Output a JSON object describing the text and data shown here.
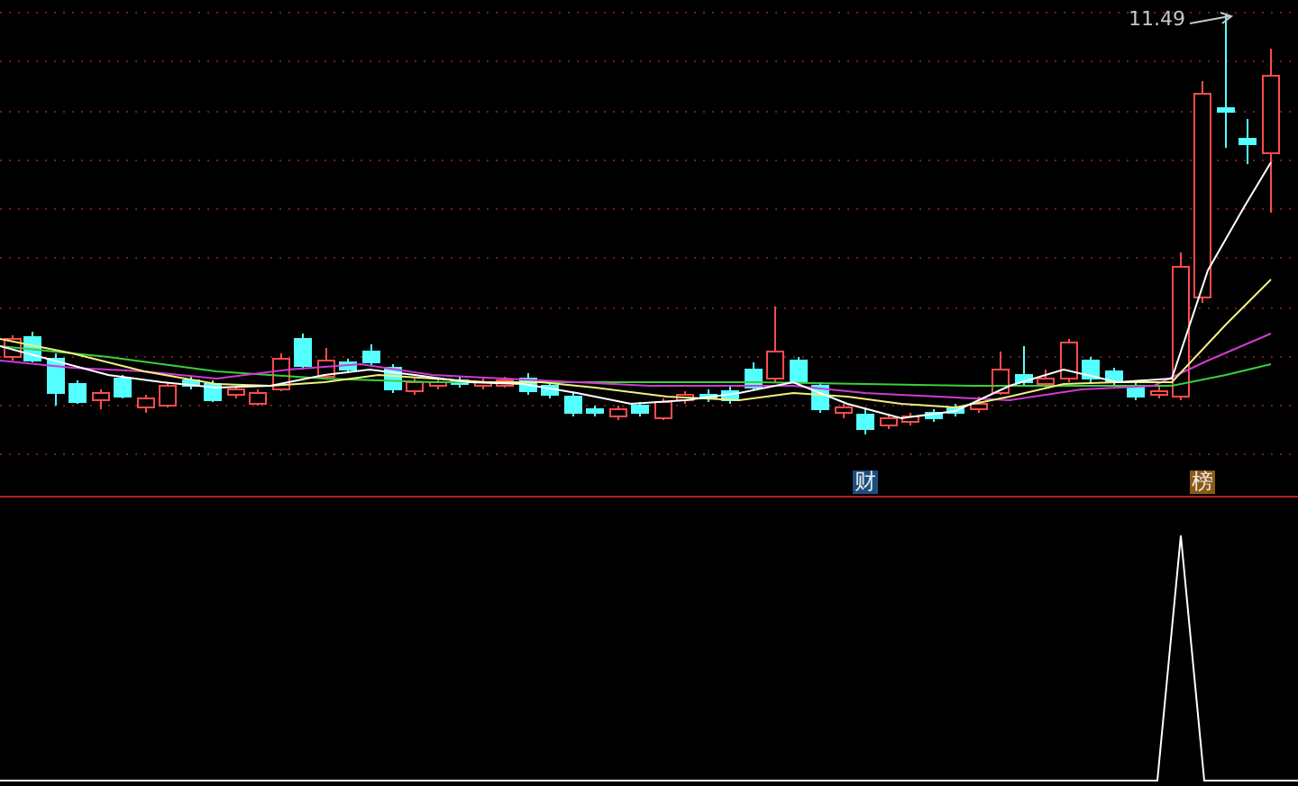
{
  "price_marker": {
    "value": "11.49"
  },
  "badges": [
    {
      "label": "财",
      "color": "#1a4f80"
    },
    {
      "label": "榜",
      "color": "#8a5a14"
    }
  ]
}
